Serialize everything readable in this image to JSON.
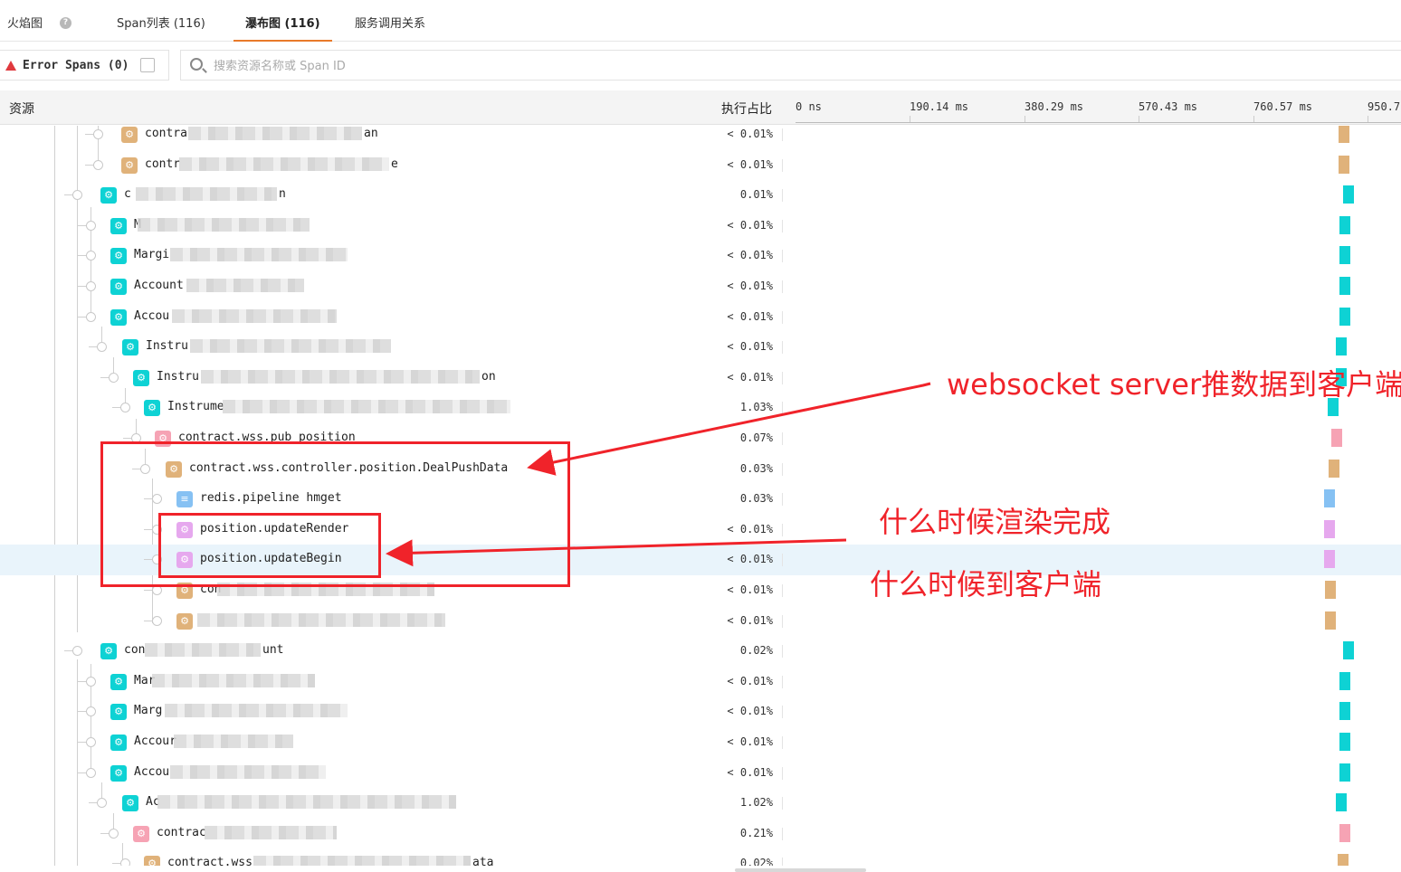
{
  "tabs": [
    {
      "label": "火焰图",
      "active": false
    },
    {
      "label": "Span列表 (116)",
      "active": false
    },
    {
      "label": "瀑布图 (116)",
      "active": true
    },
    {
      "label": "服务调用关系",
      "active": false
    }
  ],
  "help_icon": "?",
  "error_spans_label": "Error Spans (0)",
  "search": {
    "placeholder": "搜索资源名称或 Span ID"
  },
  "header": {
    "resource": "资源",
    "exec_ratio": "执行占比",
    "ticks": [
      "0 ns",
      "190.14 ms",
      "380.29 ms",
      "570.43 ms",
      "760.57 ms",
      "950.7"
    ]
  },
  "rows": [
    {
      "name": "contra",
      "tail": "an",
      "pct": "< 0.01%",
      "type": "orange"
    },
    {
      "name": "contr",
      "tail": "e",
      "pct": "< 0.01%",
      "type": "orange"
    },
    {
      "name": "c",
      "tail": "n",
      "pct": "0.01%",
      "type": "teal"
    },
    {
      "name": "M",
      "tail": "",
      "pct": "< 0.01%",
      "type": "teal"
    },
    {
      "name": "Margi",
      "tail": "",
      "pct": "< 0.01%",
      "type": "teal"
    },
    {
      "name": "Account",
      "tail": "",
      "pct": "< 0.01%",
      "type": "teal"
    },
    {
      "name": "Accou",
      "tail": "",
      "pct": "< 0.01%",
      "type": "teal"
    },
    {
      "name": "Instru",
      "tail": "",
      "pct": "< 0.01%",
      "type": "teal"
    },
    {
      "name": "Instru",
      "tail": "on",
      "pct": "< 0.01%",
      "type": "teal"
    },
    {
      "name": "Instrume",
      "tail": "",
      "pct": "1.03%",
      "type": "teal"
    },
    {
      "name": "contract.wss.pub position",
      "tail": "",
      "pct": "0.07%",
      "type": "pink"
    },
    {
      "name": "contract.wss.controller.position.DealPushData",
      "tail": "",
      "pct": "0.03%",
      "type": "orange"
    },
    {
      "name": "redis.pipeline hmget",
      "tail": "",
      "pct": "0.03%",
      "type": "db"
    },
    {
      "name": "position.updateRender",
      "tail": "",
      "pct": "< 0.01%",
      "type": "violet"
    },
    {
      "name": "position.updateBegin",
      "tail": "",
      "pct": "< 0.01%",
      "type": "violet"
    },
    {
      "name": "con",
      "tail": "",
      "pct": "< 0.01%",
      "type": "orange"
    },
    {
      "name": "",
      "tail": "",
      "pct": "< 0.01%",
      "type": "orange"
    },
    {
      "name": "con",
      "tail": "unt",
      "pct": "0.02%",
      "type": "teal"
    },
    {
      "name": "Mar",
      "tail": "",
      "pct": "< 0.01%",
      "type": "teal"
    },
    {
      "name": "Marg",
      "tail": "",
      "pct": "< 0.01%",
      "type": "teal"
    },
    {
      "name": "Accour",
      "tail": "",
      "pct": "< 0.01%",
      "type": "teal"
    },
    {
      "name": "Accou",
      "tail": "",
      "pct": "< 0.01%",
      "type": "teal"
    },
    {
      "name": "Ac",
      "tail": "",
      "pct": "1.02%",
      "type": "teal"
    },
    {
      "name": "contrac",
      "tail": "",
      "pct": "0.21%",
      "type": "pink"
    },
    {
      "name": "contract.wss",
      "tail": "ata",
      "pct": "0.02%",
      "type": "orange"
    }
  ],
  "annotations": {
    "push": "websocket server推数据到客户端",
    "render": "什么时候渲染完成",
    "arrive": "什么时候到客户端"
  },
  "colors": {
    "teal": "#0ed2d4",
    "orange": "#e0b27a",
    "pink": "#f6a3b4",
    "violet": "#e6a8ee",
    "db": "#86c1f3",
    "annotation_red": "#f0232a",
    "tab_active_underline": "#e87a2a"
  }
}
